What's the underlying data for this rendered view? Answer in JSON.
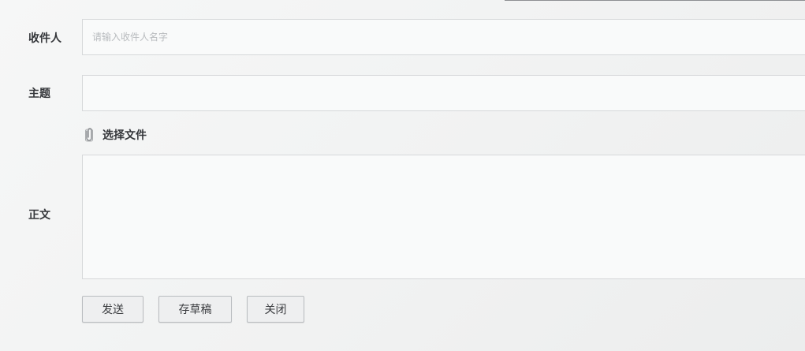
{
  "compose": {
    "recipient": {
      "label": "收件人",
      "placeholder": "请输入收件人名字",
      "value": ""
    },
    "subject": {
      "label": "主题",
      "value": ""
    },
    "attachment": {
      "label": "选择文件",
      "icon": "paperclip-icon"
    },
    "body": {
      "label": "正文",
      "value": ""
    },
    "actions": {
      "send_label": "发送",
      "save_draft_label": "存草稿",
      "close_label": "关闭"
    }
  }
}
